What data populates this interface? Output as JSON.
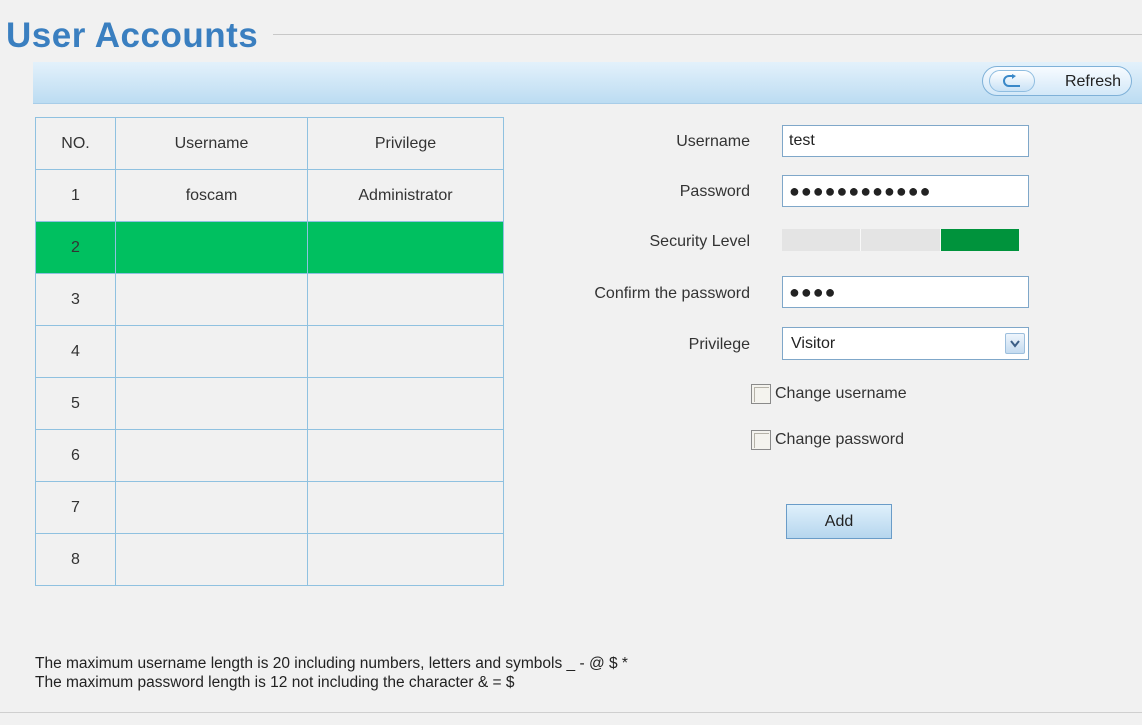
{
  "page": {
    "title": "User Accounts"
  },
  "toolbar": {
    "refresh_label": "Refresh",
    "refresh_icon": "refresh-arrow-icon"
  },
  "table": {
    "headers": [
      "NO.",
      "Username",
      "Privilege"
    ],
    "rows": [
      {
        "no": "1",
        "username": "foscam",
        "privilege": "Administrator"
      },
      {
        "no": "2",
        "username": "",
        "privilege": ""
      },
      {
        "no": "3",
        "username": "",
        "privilege": ""
      },
      {
        "no": "4",
        "username": "",
        "privilege": ""
      },
      {
        "no": "5",
        "username": "",
        "privilege": ""
      },
      {
        "no": "6",
        "username": "",
        "privilege": ""
      },
      {
        "no": "7",
        "username": "",
        "privilege": ""
      },
      {
        "no": "8",
        "username": "",
        "privilege": ""
      }
    ],
    "selected_row": "2",
    "selected_color": "#00c060"
  },
  "form": {
    "username_label": "Username",
    "username_value": "test",
    "password_label": "Password",
    "password_value": "●●●●●●●●●●●●",
    "security_label": "Security Level",
    "security_level": "3 of 3",
    "security_color": "#00933c",
    "confirm_label": "Confirm the password",
    "confirm_value": "●●●●",
    "privilege_label": "Privilege",
    "privilege_value": "Visitor",
    "change_username_label": "Change username",
    "change_username_checked": false,
    "change_password_label": "Change password",
    "change_password_checked": false,
    "add_label": "Add"
  },
  "notes": {
    "line1": "The maximum username length is 20 including numbers, letters and symbols _ - @ $ *",
    "line2": "The maximum password length is 12 not including the character & = $"
  },
  "colors": {
    "title": "#3a7fc0",
    "accent_bar": "#bcdcf2"
  }
}
